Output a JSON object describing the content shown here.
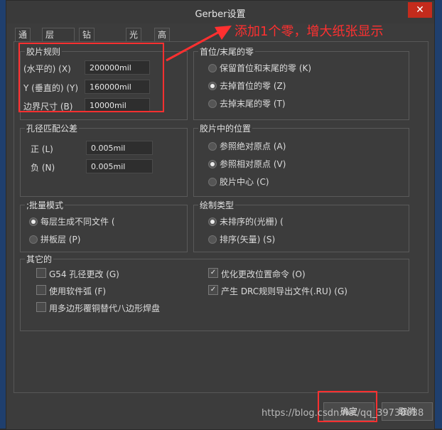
{
  "window": {
    "title": "Gerber设置",
    "close_glyph": "✕"
  },
  "tabs": [
    "通用",
    "层",
    "钻孔图层",
    "光圈",
    "高级"
  ],
  "film_rules": {
    "title": "胶片规则",
    "x_label": "(水平的) (X)",
    "x_value": "200000mil",
    "y_label": "Y (垂直的) (Y)",
    "y_value": "160000mil",
    "border_label": "边界尺寸 (B)",
    "border_value": "10000mil"
  },
  "leading_zeros": {
    "title": "首位/末尾的零",
    "options": [
      "保留首位和末尾的零 (K)",
      "去掉首位的零 (Z)",
      "去掉末尾的零 (T)"
    ],
    "selected": 1
  },
  "hole_tolerance": {
    "title": "孔径匹配公差",
    "pos_label": "正 (L)",
    "pos_value": "0.005mil",
    "neg_label": "负 (N)",
    "neg_value": "0.005mil"
  },
  "film_position": {
    "title": "胶片中的位置",
    "options": [
      "参照绝对原点 (A)",
      "参照相对原点 (V)",
      "胶片中心 (C)"
    ],
    "selected": 1
  },
  "batch_mode": {
    "title": ";批量模式",
    "options": [
      "每层生成不同文件 (",
      "拼板层 (P)"
    ],
    "selected": 0
  },
  "plot_type": {
    "title": "绘制类型",
    "options": [
      "未排序的(光栅) (",
      "排序(矢量) (S)"
    ],
    "selected": 0
  },
  "other": {
    "title": "其它的",
    "checks": [
      {
        "label": "G54 孔径更改 (G)",
        "checked": false
      },
      {
        "label": "使用软件弧 (F)",
        "checked": false
      },
      {
        "label": "用多边形覆铜替代八边形焊盘",
        "checked": false
      },
      {
        "label": "优化更改位置命令 (O)",
        "checked": true
      },
      {
        "label": "产生 DRC规则导出文件(.RU) (G)",
        "checked": true
      }
    ]
  },
  "buttons": {
    "ok": "确定",
    "cancel": "取消"
  },
  "annotation": {
    "text": "添加1个零，增大纸张显示"
  },
  "watermark": "https://blog.csdn.net/qq_39738638",
  "colors": {
    "annotation": "#ff3030",
    "close": "#c42b1c"
  }
}
